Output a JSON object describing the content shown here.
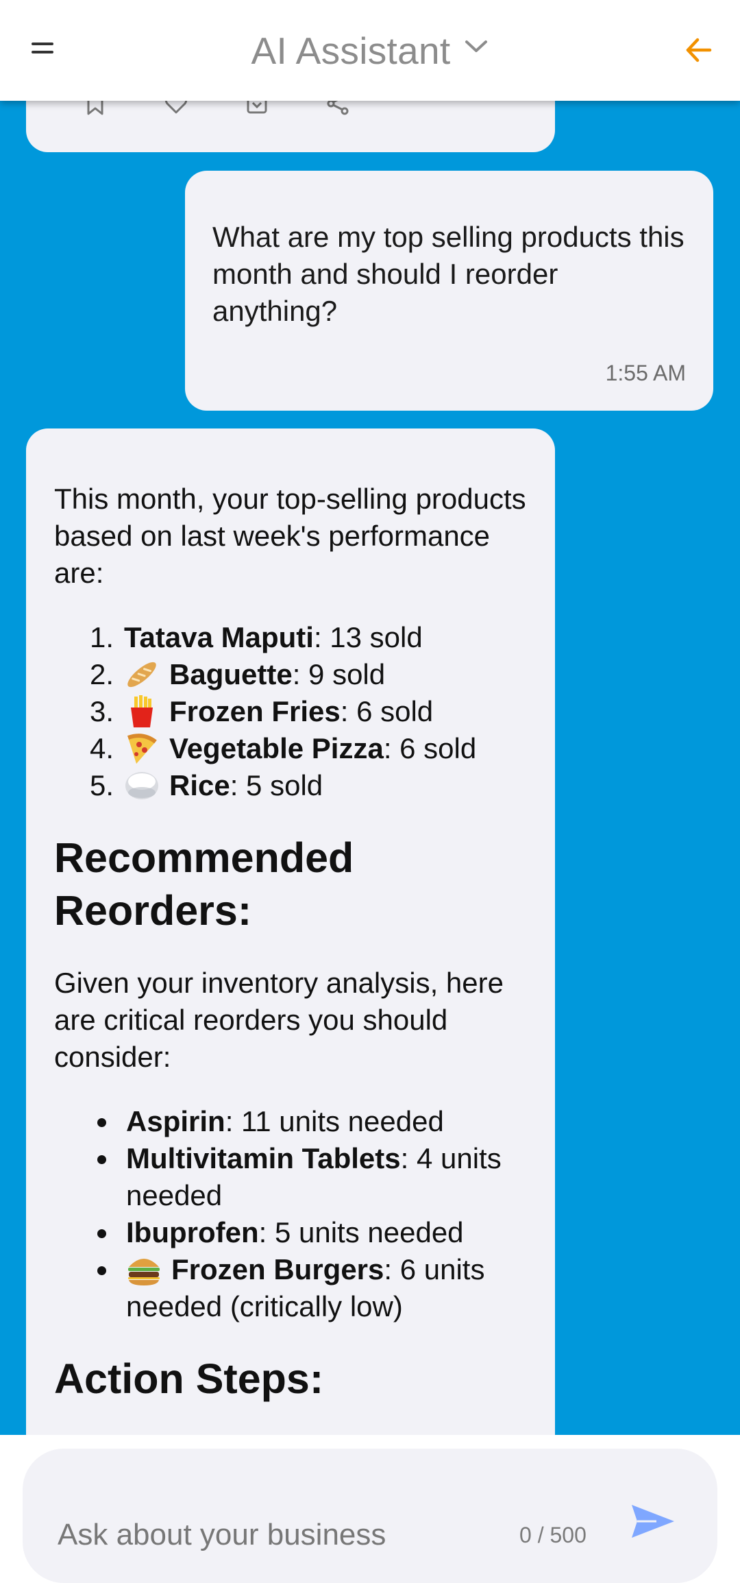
{
  "header": {
    "title": "AI Assistant",
    "icons": {
      "menu": "menu-icon",
      "dropdown": "chevron-down-icon",
      "back": "back-arrow-icon"
    },
    "accent_color": "#f29100"
  },
  "colors": {
    "background": "#0098db",
    "bubble": "#f2f2f7",
    "send": "#7fa7ff"
  },
  "messages": {
    "user": {
      "text": "What are my top selling products this month and should I reorder anything?",
      "time": "1:55 AM"
    },
    "assistant": {
      "intro": "This month, your top-selling products based on last week's performance are:",
      "top_products": [
        {
          "num": "1.",
          "name": "Tatava Maputi",
          "detail": ": 13 sold",
          "icon": ""
        },
        {
          "num": "2.",
          "name": "Baguette",
          "detail": ": 9 sold",
          "icon": "baguette-icon"
        },
        {
          "num": "3.",
          "name": "Frozen Fries",
          "detail": ": 6 sold",
          "icon": "fries-icon"
        },
        {
          "num": "4.",
          "name": "Vegetable Pizza",
          "detail": ": 6 sold",
          "icon": "pizza-icon"
        },
        {
          "num": "5.",
          "name": "Rice",
          "detail": ": 5 sold",
          "icon": "rice-icon"
        }
      ],
      "reorder_heading": "Recommended Reorders:",
      "reorder_intro": "Given your inventory analysis, here are critical reorders you should consider:",
      "reorders": [
        {
          "name": "Aspirin",
          "detail": ": 11 units needed",
          "icon": ""
        },
        {
          "name": "Multivitamin Tablets",
          "detail": ": 4 units needed",
          "icon": ""
        },
        {
          "name": "Ibuprofen",
          "detail": ": 5 units needed",
          "icon": ""
        },
        {
          "name": "Frozen Burgers",
          "detail": ": 6 units needed (critically low)",
          "icon": "burger-icon"
        }
      ],
      "action_heading": "Action Steps:"
    },
    "previous_actions": [
      "bookmark-icon",
      "heart-icon",
      "save-icon",
      "share-icon"
    ]
  },
  "input": {
    "placeholder": "Ask about your business",
    "value": "",
    "counter": "0 / 500",
    "send_icon": "send-icon"
  }
}
